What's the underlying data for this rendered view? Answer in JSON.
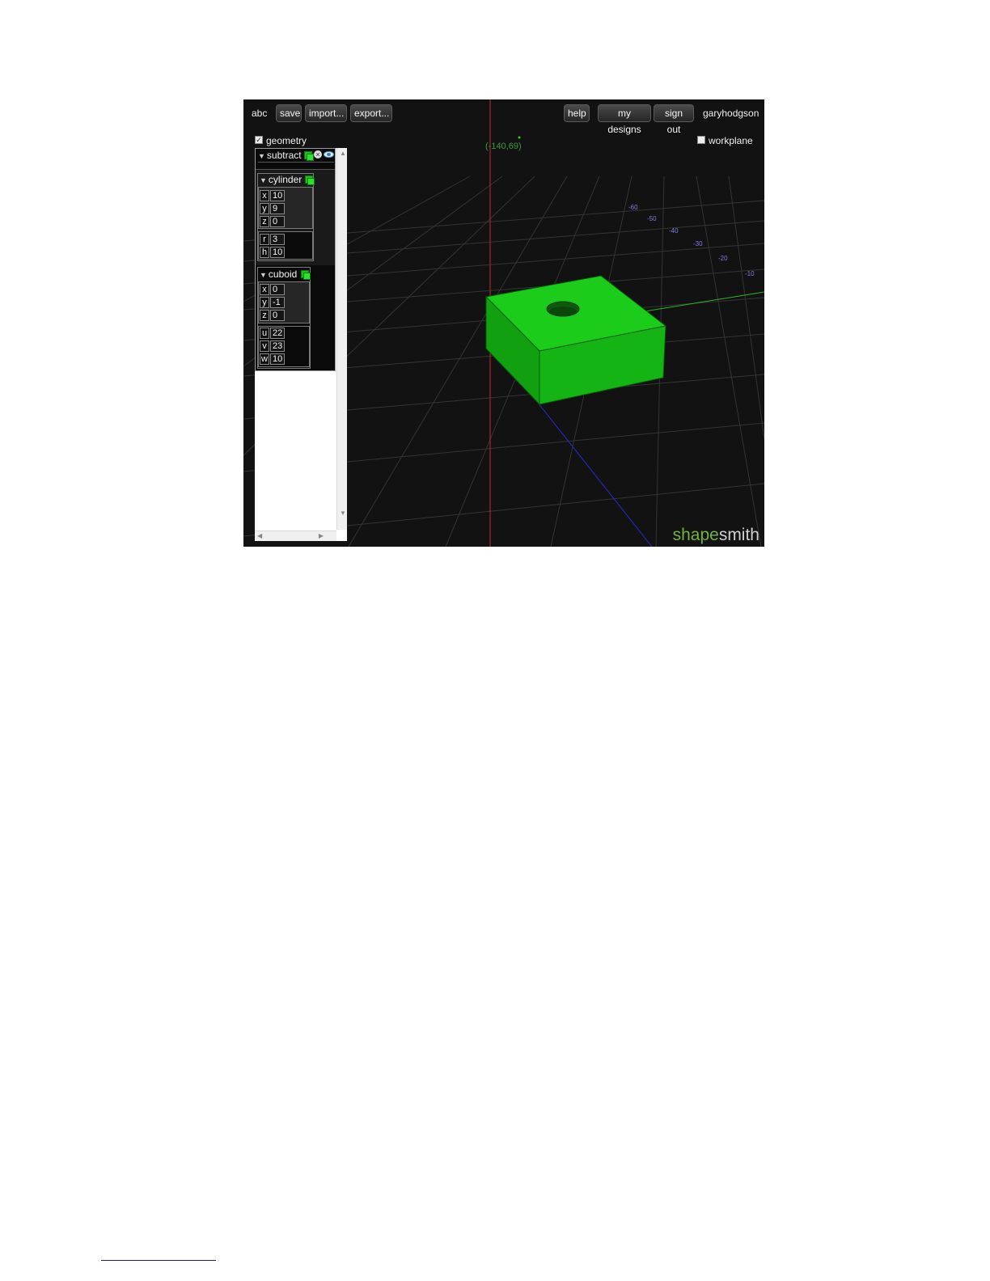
{
  "header": {
    "design_name": "abc",
    "buttons": {
      "save": "save",
      "import": "import...",
      "export": "export...",
      "help": "help",
      "my_designs": "my designs",
      "sign_out": "sign out"
    },
    "username": "garyhodgson"
  },
  "toggles": {
    "geometry": {
      "label": "geometry",
      "checked": true
    },
    "workplane": {
      "label": "workplane",
      "checked": false
    }
  },
  "cursor_readout": "(-140,69)",
  "axis_labels": [
    "-60",
    "-50",
    "-40",
    "-30",
    "-20",
    "-10"
  ],
  "tree": {
    "root": {
      "label": "subtract"
    },
    "cylinder": {
      "label": "cylinder",
      "origin": [
        {
          "key": "x",
          "value": "10"
        },
        {
          "key": "y",
          "value": "9"
        },
        {
          "key": "z",
          "value": "0"
        }
      ],
      "params": [
        {
          "key": "r",
          "value": "3"
        },
        {
          "key": "h",
          "value": "10"
        }
      ]
    },
    "cuboid": {
      "label": "cuboid",
      "origin": [
        {
          "key": "x",
          "value": "0"
        },
        {
          "key": "y",
          "value": "-1"
        },
        {
          "key": "z",
          "value": "0"
        }
      ],
      "params": [
        {
          "key": "u",
          "value": "22"
        },
        {
          "key": "v",
          "value": "23"
        },
        {
          "key": "w",
          "value": "10"
        }
      ]
    }
  },
  "logo": {
    "part1": "shape",
    "part2": "smith"
  },
  "colors": {
    "solid": "#16c416",
    "grid": "#3a3a3a",
    "x_axis": "#2bb52b",
    "y_axis": "#c42a2a",
    "z_axis": "#2a2ac4"
  }
}
